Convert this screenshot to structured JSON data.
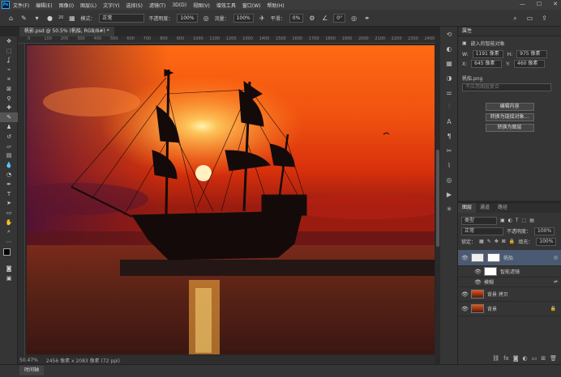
{
  "menu": [
    "文件(F)",
    "编辑(E)",
    "图像(I)",
    "图层(L)",
    "文字(Y)",
    "选择(S)",
    "滤镜(T)",
    "3D(D)",
    "视图(V)",
    "增效工具",
    "窗口(W)",
    "帮助(H)"
  ],
  "options": {
    "mode_label": "模式：",
    "mode": "正常",
    "opacity_label": "不透明度：",
    "opacity": "100%",
    "flow_label": "流量：",
    "flow": "100%",
    "smooth_label": "平滑：",
    "smooth": "0%",
    "angle": "0°",
    "brush_size": "20"
  },
  "document": {
    "tab": "帆影.psd @ 50.5% (帆船, RGB/8#) *",
    "zoom": "50.47%",
    "info": "2456 像素 x 2083 像素 (72 ppi)"
  },
  "ruler": [
    "0",
    "100",
    "200",
    "300",
    "400",
    "500",
    "600",
    "700",
    "800",
    "900",
    "1000",
    "1100",
    "1200",
    "1300",
    "1400",
    "1500",
    "1600",
    "1700",
    "1800",
    "1900",
    "2000",
    "2100",
    "2200",
    "2300",
    "2400",
    "2500"
  ],
  "timeline": "时间轴",
  "properties": {
    "title": "属性",
    "type": "嵌入的智能对象",
    "w_label": "W:",
    "w": "1191 像素",
    "h_label": "H:",
    "h": "975 像素",
    "x_label": "X:",
    "x": "645 像素",
    "y_label": "Y:",
    "y": "460 像素",
    "file": "帆船.png",
    "comp": "不应用图层复合",
    "btn1": "编辑内容",
    "btn2": "转换为链接对象...",
    "btn3": "转换为图层"
  },
  "layers": {
    "tabs": [
      "图层",
      "通道",
      "路径"
    ],
    "kind": "类型",
    "blend": "正常",
    "opacity_label": "不透明度：",
    "opacity": "100%",
    "lock_label": "锁定：",
    "fill_label": "填充：",
    "fill": "100%",
    "items": [
      {
        "name": "帆船",
        "active": true
      },
      {
        "name": "智能滤镜",
        "sub": true
      },
      {
        "name": "模糊",
        "sub2": true
      },
      {
        "name": "背景 拷贝"
      },
      {
        "name": "背景",
        "locked": true
      }
    ]
  },
  "colors": {
    "accent": "#31a8ff",
    "sky_top": "#b8220f",
    "sky_mid": "#e8520f",
    "sun": "#ffe680",
    "sea": "#4a1d14"
  }
}
